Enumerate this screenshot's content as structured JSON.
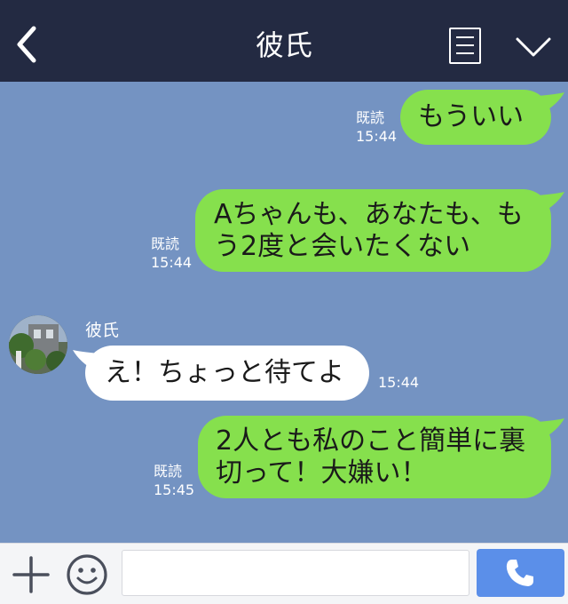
{
  "header": {
    "title": "彼氏",
    "back_icon": "chevron-left-icon",
    "menu_icon": "note-icon",
    "collapse_icon": "chevron-down-icon",
    "bg_color": "#232a42"
  },
  "chat": {
    "bg_color": "#7493c2",
    "sent_bubble_color": "#86e04d",
    "received_bubble_color": "#ffffff",
    "messages": [
      {
        "side": "me",
        "line1": "もういい",
        "line2": "",
        "read": "既読",
        "time": "15:44"
      },
      {
        "side": "me",
        "line1": "Aちゃんも、あなたも、も",
        "line2": "う2度と会いたくない",
        "read": "既読",
        "time": "15:44"
      },
      {
        "side": "them",
        "sender": "彼氏",
        "line1": "え！ちょっと待てよ",
        "line2": "",
        "time": "15:44"
      },
      {
        "side": "me",
        "line1": "2人とも私のこと簡単に裏",
        "line2": "切って！大嫌い！",
        "read": "既読",
        "time": "15:45"
      }
    ]
  },
  "footer": {
    "plus_icon": "plus-icon",
    "emoji_icon": "smiley-icon",
    "input_value": "",
    "input_placeholder": "",
    "call_icon": "phone-icon",
    "call_color": "#5b8fe9"
  }
}
